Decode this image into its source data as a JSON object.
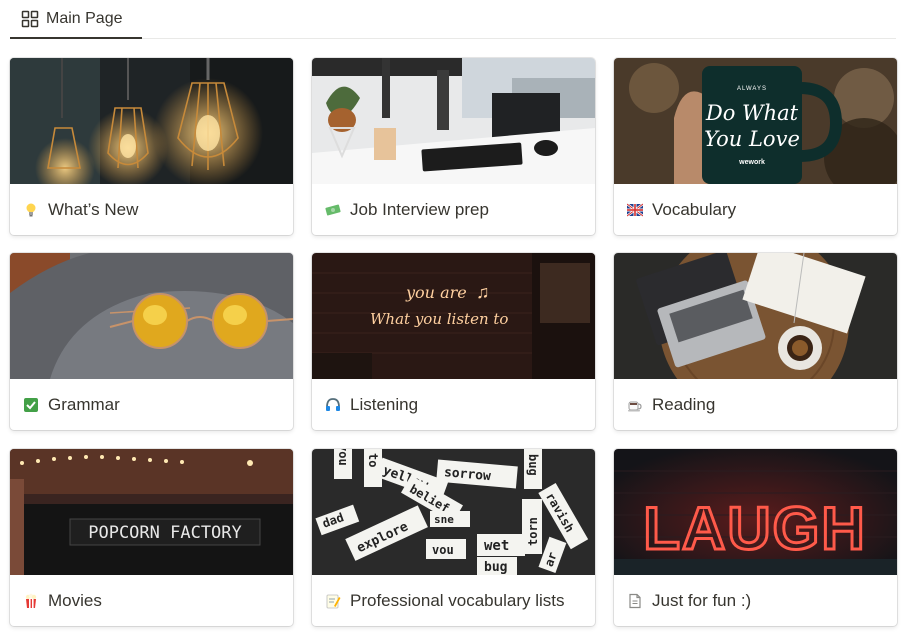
{
  "tab": {
    "label": "Main Page"
  },
  "cover_texts": {
    "mug": [
      "ALWAYS",
      "Do What",
      "You Love",
      "wework"
    ],
    "neon": [
      "you are",
      "What you listen to"
    ],
    "marquee": "POPCORN FACTORY",
    "words": [
      "you",
      "to",
      "yellow",
      "sorrow",
      "belief",
      "are",
      "bug",
      "explore",
      "ravish",
      "torn",
      "sne",
      "wet",
      "bug",
      "vou",
      "dad",
      "ar"
    ],
    "laugh": "LAUGH"
  },
  "cards": [
    {
      "title": "What’s New",
      "emoji": "lightbulb-icon"
    },
    {
      "title": "Job Interview prep",
      "emoji": "money-icon"
    },
    {
      "title": "Vocabulary",
      "emoji": "uk-flag-icon"
    },
    {
      "title": "Grammar",
      "emoji": "checkmark-icon"
    },
    {
      "title": "Listening",
      "emoji": "headphones-icon"
    },
    {
      "title": "Reading",
      "emoji": "coffee-icon"
    },
    {
      "title": "Movies",
      "emoji": "popcorn-icon"
    },
    {
      "title": "Professional vocabulary lists",
      "emoji": "memo-icon"
    },
    {
      "title": "Just for fun :)",
      "emoji": "page-icon"
    }
  ]
}
